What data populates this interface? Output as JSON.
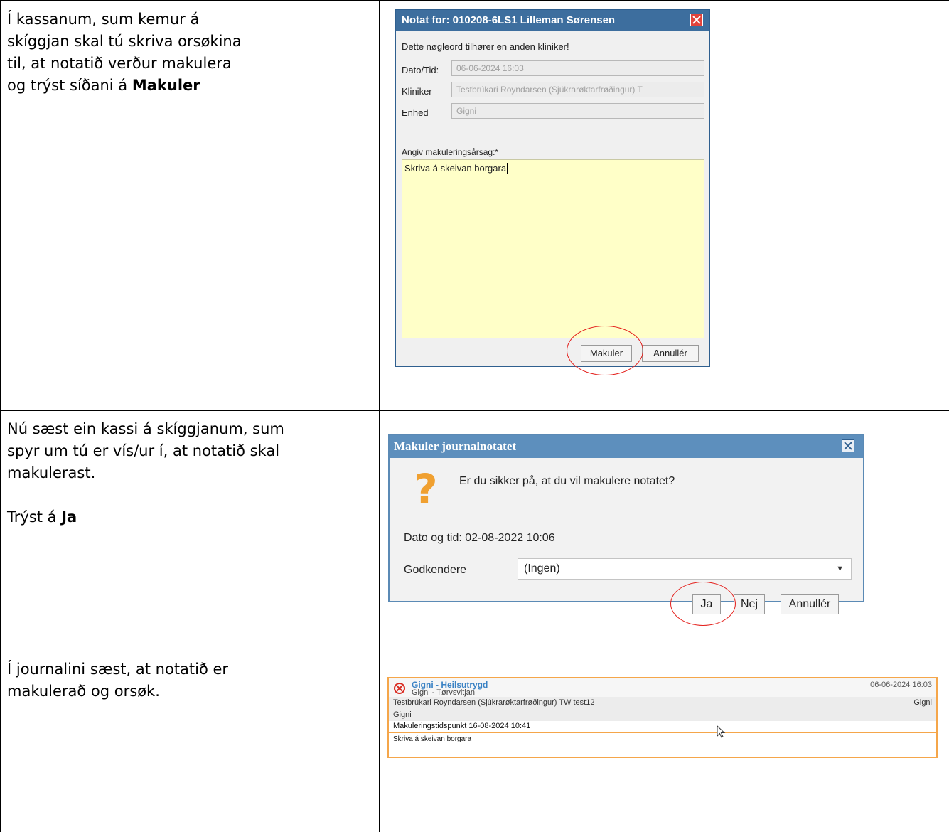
{
  "rows": [
    {
      "instruction_lines": [
        "Í kassanum, sum kemur á",
        "skíggjan skal tú skriva orsøkina",
        "til, at notatið verður makulera"
      ],
      "instruction_last_prefix": "og trýst síðani á ",
      "instruction_last_bold": "Makuler"
    },
    {
      "instruction_lines": [
        "Nú sæst ein kassi á skíggjanum, sum",
        "spyr um tú er vís/ur í, at notatið skal",
        "makulerast."
      ],
      "instruction_last_prefix": "Trýst á ",
      "instruction_last_bold": "Ja"
    },
    {
      "instruction_lines": [
        "Í journalini sæst, at notatið er",
        "makulerað og orsøk."
      ]
    }
  ],
  "dialog1": {
    "title": "Notat for: 010208-6LS1 Lilleman Sørensen",
    "warning": "Dette nøgleord tilhører en anden kliniker!",
    "fields": [
      {
        "label": "Dato/Tid:",
        "value": "06-06-2024 16:03"
      },
      {
        "label": "Kliniker",
        "value": "Testbrúkari Royndarsen (Sjúkrarøktarfrøðingur) T"
      },
      {
        "label": "Enhed",
        "value": "Gigni"
      }
    ],
    "area_label": "Angiv makuleringsårsag:*",
    "area_value": "Skriva á skeivan borgara",
    "buttons": {
      "makuler": "Makuler",
      "annuller": "Annullér"
    }
  },
  "dialog2": {
    "title": "Makuler journalnotatet",
    "question": "Er du sikker på, at du vil makulere notatet?",
    "date_text": "Dato og tid: 02-08-2022 10:06",
    "godkendere_label": "Godkendere",
    "godkendere_value": "(Ingen)",
    "buttons": {
      "ja": "Ja",
      "nej": "Nej",
      "annuller": "Annullér"
    }
  },
  "journal": {
    "title": "Gigni - Heilsutrygd",
    "subtitle": "Gigni - Tørvsvitjan",
    "date": "06-06-2024 16:03",
    "author": "Testbrúkari Royndarsen (Sjúkrarøktarfrøðingur) TW test12",
    "unit_right": "Gigni",
    "unit": "Gigni",
    "timestamp": "Makuleringstidspunkt 16-08-2024 10:41",
    "reason": "Skriva á skeivan borgara"
  },
  "colors": {
    "dialog1_title_bg": "#3d6e9e",
    "dialog2_title_bg": "#5d8fbd",
    "textarea_bg": "#ffffc8",
    "highlight_circle": "#e4201c",
    "journal_border": "#f5a64a",
    "journal_title": "#3a82c4",
    "voided_icon": "#d9281e"
  },
  "icons": [
    "close-icon",
    "question-icon",
    "dropdown-arrow-icon",
    "voided-x-icon",
    "mouse-cursor-icon"
  ]
}
